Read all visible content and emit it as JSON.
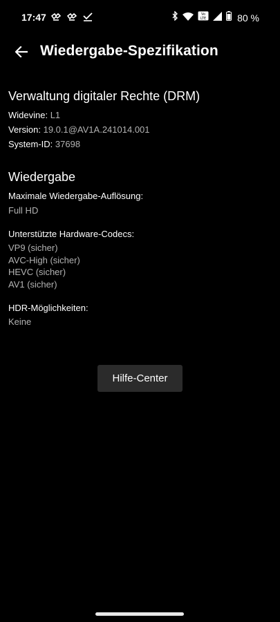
{
  "status_bar": {
    "time": "17:47",
    "battery_percent": "80 %",
    "volte_label": "Vo LTE",
    "icons_left": [
      "netflix-download-icon",
      "netflix-download-icon",
      "check-icon"
    ],
    "icons_right": [
      "bluetooth-icon",
      "wifi-icon",
      "volte-icon",
      "signal-icon",
      "battery-icon"
    ]
  },
  "header": {
    "title": "Wiedergabe-Spezifikation",
    "back_icon": "arrow-left-icon"
  },
  "drm": {
    "title": "Verwaltung digitaler Rechte (DRM)",
    "widevine_label": "Widevine: ",
    "widevine_value": "L1",
    "version_label": "Version: ",
    "version_value": "19.0.1@AV1A.241014.001",
    "system_id_label": "System-ID: ",
    "system_id_value": "37698"
  },
  "playback": {
    "title": "Wiedergabe",
    "max_resolution_label": "Maximale Wiedergabe-Auflösung:",
    "max_resolution_value": "Full HD",
    "codecs_label": "Unterstützte Hardware-Codecs:",
    "codecs": [
      "VP9 (sicher)",
      "AVC-High (sicher)",
      "HEVC (sicher)",
      "AV1 (sicher)"
    ],
    "hdr_label": "HDR-Möglichkeiten:",
    "hdr_value": "Keine"
  },
  "help_button_label": "Hilfe-Center",
  "colors": {
    "background": "#000000",
    "text_primary": "#ffffff",
    "text_secondary": "#b3b3b3",
    "button_bg": "#2b2b2b"
  }
}
